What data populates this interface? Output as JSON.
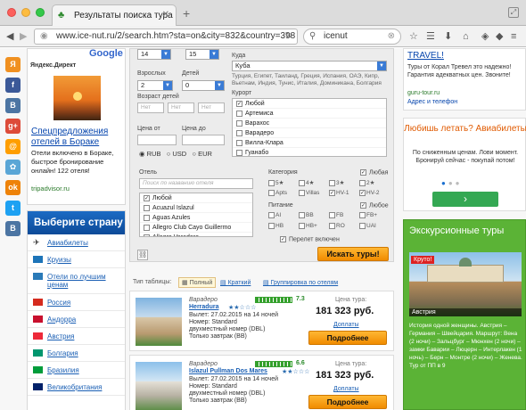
{
  "browser": {
    "tab_title": "Результаты поиска тура",
    "url": "www.ice-nut.ru/2/search.htm?sta=on&city=832&country=398",
    "search_query": "icenut"
  },
  "left_ad": {
    "label": "Яндекс.Директ",
    "google": "Google",
    "title": "Спецпредложения отелей в Бораке",
    "text": "Отели включено в Бораке, быстрое бронирование онлайн! 122 отеля!",
    "link": "tripadvisor.ru"
  },
  "country_box": {
    "header": "Выберите страну",
    "items": [
      {
        "label": "Авиабилеты",
        "color": "#3a6bbf"
      },
      {
        "label": "Круизы",
        "color": "#1d74b8"
      },
      {
        "label": "Отели по лучшим ценам",
        "color": "#2a7ab8"
      },
      {
        "label": "Россия",
        "color": "#d52b1e"
      },
      {
        "label": "Андорра",
        "color": "#c8102e"
      },
      {
        "label": "Австрия",
        "color": "#ed2939"
      },
      {
        "label": "Болгария",
        "color": "#00966e"
      },
      {
        "label": "Бразилия",
        "color": "#009c3b"
      },
      {
        "label": "Великобритания",
        "color": "#012169"
      }
    ]
  },
  "form": {
    "nights_from": "14",
    "nights_to": "15",
    "adults_label": "Взрослых",
    "adults": "2",
    "children_label": "Детей",
    "children": "0",
    "children_age_label": "Возраст детей",
    "age_placeholder": "Нет",
    "price_from_label": "Цена от",
    "price_to_label": "Цена до",
    "currencies": [
      "RUB",
      "USD",
      "EUR"
    ],
    "country_label": "Куда",
    "country": "Куба",
    "country_hint": "Турция, Египет, Таиланд, Греция, Испания, ОАЭ, Кипр, Вьетнам, Индия, Тунис, Италия, Доминикана, Болгария",
    "resort_label": "Курорт",
    "resorts": [
      "Любой",
      "Артемиса",
      "Варахос",
      "Варадеро",
      "Вилла-Клара",
      "Гуанабо"
    ],
    "hotel_label": "Отель",
    "hotel_placeholder": "Поиск по названию отеля",
    "hotels": [
      "Любой",
      "Acuazul Islazul",
      "Aguas Azules",
      "Allegro Club Cayo Guillermo",
      "Allegro Varadero"
    ],
    "category_label": "Категория",
    "category_any": "Любая",
    "categories": [
      "5★",
      "4★",
      "3★",
      "2★",
      "Apts",
      "Villas",
      "HV-1",
      "HV-2"
    ],
    "meal_label": "Питание",
    "meal_any": "Любое",
    "meals": [
      "AI",
      "BB",
      "FB",
      "FB+",
      "HB",
      "HB+",
      "RO",
      "UAI"
    ],
    "flight_included": "Перелет включен",
    "search_button": "Искать туры!"
  },
  "table_type": {
    "label": "Тип таблицы:",
    "options": [
      "Полный",
      "Краткий",
      "Группировка по отелям"
    ]
  },
  "results": [
    {
      "resort": "Варадеро",
      "hotel": "Herradura",
      "stars": "★★☆☆☆",
      "rating": "7.3",
      "depart": "Вылет: 27.02.2015 на 14 ночей",
      "room": "Номер: Standard",
      "room_type": "двухместный номер (DBL)",
      "meal": "Только завтрак (BB)",
      "price_label": "Цена тура:",
      "price": "181 323 руб.",
      "extra": "Доплаты",
      "button": "Подробнее"
    },
    {
      "resort": "Варадеро",
      "hotel": "Islazul Pullman Dos Mares",
      "stars": "★★☆☆☆",
      "rating": "6.6",
      "depart": "Вылет: 27.02.2015 на 14 ночей",
      "room": "Номер: Standard",
      "room_type": "двухместный номер (DBL)",
      "meal": "Только завтрак (BB)",
      "price_label": "Цена тура:",
      "price": "181 323 руб.",
      "extra": "Доплаты",
      "button": "Подробнее"
    }
  ],
  "right_ads": {
    "ad1_title": "TRAVEL!",
    "ad1_text": "Туры от Корал Тревел это надежно! Гарантия адекватных цен. Звоните!",
    "ad1_link": "guru-tour.ru",
    "ad1_link2": "Адрес и телефон",
    "ad2_title": "Любишь летать? Авиабилеты",
    "ad2_text": "По сниженным ценам. Лови момент. Бронируй сейчас - покупай потом!",
    "ad2_button": "›",
    "ad3_title": "Экскурсионные туры",
    "ad3_badge": "Круто!",
    "ad3_caption": "Австрия",
    "ad3_text": "История одной женщины. Австрия – Германия – Швейцария. Маршрут: Вена (2 ночи) – Зальцбург – Мюнхен (2 ночи) – замки Баварии – Люцерн – Интерлакен (1 ночь) – Берн – Монтре (2 ночи) – Женева. Тур от ПП в 9"
  }
}
